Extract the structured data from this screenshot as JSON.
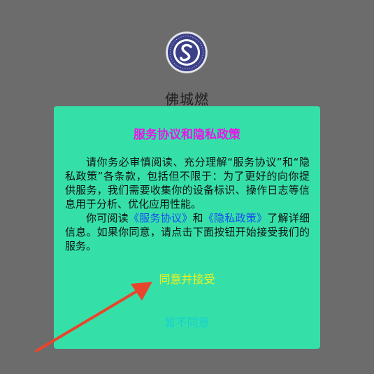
{
  "app": {
    "name": "佛城燃",
    "logo_icon": "company-seal-logo-icon"
  },
  "dialog": {
    "title": "服务协议和隐私政策",
    "paragraph1": "请你务必审慎阅读、充分理解“服务协议”和“隐私政策”各条款，包括但不限于：为了更好的向你提供服务，我们需要收集你的设备标识、操作日志等信息用于分析、优化应用性能。",
    "paragraph2_prefix": "你可阅读",
    "link_service": "《服务协议》",
    "paragraph2_and": "和",
    "link_privacy": "《隐私政策》",
    "paragraph2_suffix": "了解详细信息。如果你同意，请点击下面按钮开始接受我们的服务。",
    "agree_label": "同意并接受",
    "disagree_label": "暂不同意"
  },
  "colors": {
    "background": "#6c6c6c",
    "dialog_bg": "#35e0a8",
    "title": "#e815e8",
    "link": "#1a4df0",
    "agree": "#f2f21a",
    "disagree": "#18d0d0",
    "annotation_arrow": "#e8452c"
  }
}
